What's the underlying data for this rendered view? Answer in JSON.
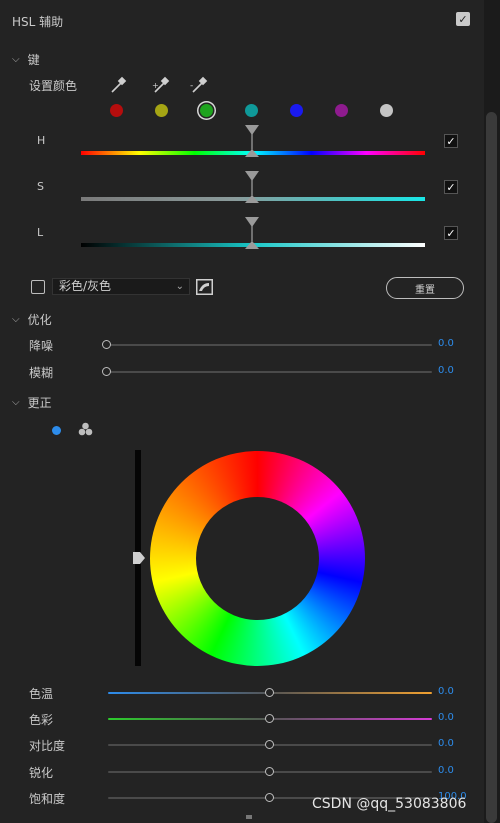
{
  "header": {
    "title": "HSL 辅助",
    "enabled": true
  },
  "key": {
    "section_label": "键",
    "set_color_label": "设置颜色",
    "eyedroppers": [
      "eyedropper-icon",
      "eyedropper-add-icon",
      "eyedropper-subtract-icon"
    ],
    "swatches": [
      "#b50d0d",
      "#a5a514",
      "#1ea31e",
      "#0f9999",
      "#1a1af0",
      "#8e1b8e",
      "#c4c4c4"
    ],
    "selected_swatch": 2,
    "channels": [
      {
        "label": "H",
        "checked": true
      },
      {
        "label": "S",
        "checked": true
      },
      {
        "label": "L",
        "checked": true
      }
    ],
    "color_gray_checkbox": false,
    "color_gray_dropdown": "彩色/灰色",
    "reset_button": "重置"
  },
  "refine": {
    "section_label": "优化",
    "sliders": [
      {
        "label": "降噪",
        "value": "0.0"
      },
      {
        "label": "模糊",
        "value": "0.0"
      }
    ]
  },
  "correction": {
    "section_label": "更正",
    "sliders": [
      {
        "label": "色温",
        "value": "0.0"
      },
      {
        "label": "色彩",
        "value": "0.0"
      },
      {
        "label": "对比度",
        "value": "0.0"
      },
      {
        "label": "锐化",
        "value": "0.0"
      },
      {
        "label": "饱和度",
        "value": "100.0"
      }
    ]
  },
  "watermark": "CSDN @qq_53083806"
}
